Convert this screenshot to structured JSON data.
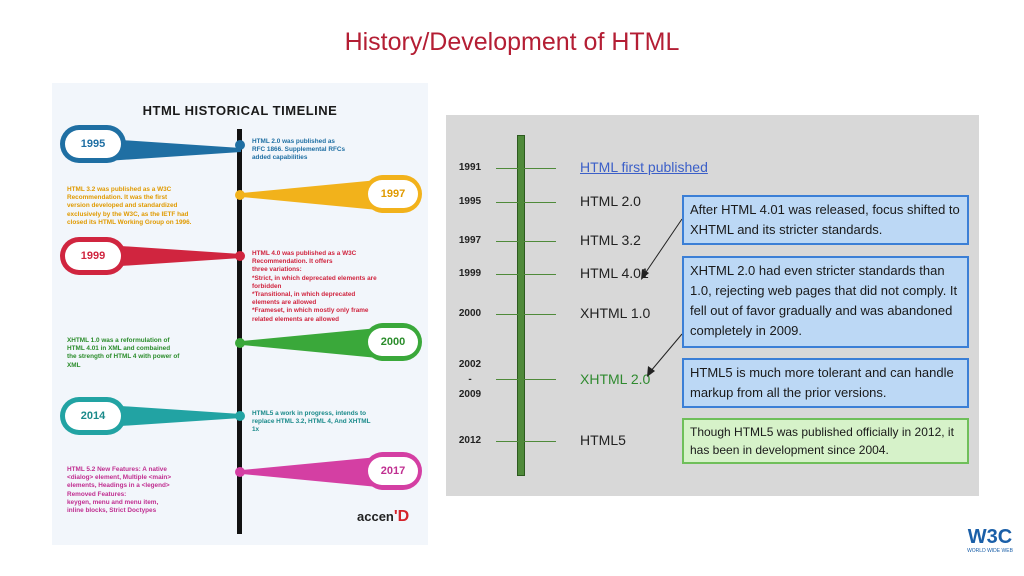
{
  "slide": {
    "title": "History/Development of HTML"
  },
  "left_infographic": {
    "heading": "HTML HISTORICAL TIMELINE",
    "entries": [
      {
        "year": "1995",
        "color": "#1f6fa3",
        "text": "HTML 2.0 was published as\nRFC 1866. Supplemental RFCs\nadded capabilities"
      },
      {
        "year": "1997",
        "color": "#f2b21b",
        "text": "HTML 3.2 was published as a W3C\nRecommendation. It was the first\nversion developed and standardized\nexclusively by the W3C, as the IETF had\nclosed its HTML Working Group on 1996."
      },
      {
        "year": "1999",
        "color": "#d0253f",
        "text": "HTML 4.0 was published as a W3C\nRecommendation. It offers\nthree variations:\n*Strict, in which deprecated elements are\nforbidden\n*Transitional, in which deprecated\nelements are allowed\n*Frameset, in which mostly only frame\nrelated elements are allowed"
      },
      {
        "year": "2000",
        "color": "#3aa83a",
        "text": "XHTML 1.0 was a  reformulation of\nHTML 4.01 in XML and combained\nthe strength of HTML 4 with  power of\nXML"
      },
      {
        "year": "2014",
        "color": "#22a3a3",
        "text": "HTML5 a work in progress, intends to\nreplace HTML 3.2, HTML 4,  And XHTML\n1x"
      },
      {
        "year": "2017",
        "color": "#d43fa3",
        "text": "HTML 5.2 New Features: A native\n<dialog> element,  Multiple <main>\nelements,  Headings in a <legend>\nRemoved Features:\nkeygen, menu and menu item,\ninline blocks, Strict Doctypes"
      }
    ],
    "logo": {
      "main": "accen",
      "accent": "'D"
    }
  },
  "right_timeline": {
    "rows": [
      {
        "year": "1991",
        "version": "HTML first published",
        "style": "link"
      },
      {
        "year": "1995",
        "version": "HTML 2.0",
        "style": "normal"
      },
      {
        "year": "1997",
        "version": "HTML 3.2",
        "style": "normal"
      },
      {
        "year": "1999",
        "version": "HTML 4.01",
        "style": "normal"
      },
      {
        "year": "2000",
        "version": "XHTML 1.0",
        "style": "normal"
      },
      {
        "year": "2002\n-\n2009",
        "version": "XHTML 2.0",
        "style": "green"
      },
      {
        "year": "2012",
        "version": "HTML5",
        "style": "normal"
      }
    ],
    "callouts": [
      {
        "text": "After HTML 4.01 was released, focus shifted to XHTML and its stricter standards.",
        "style": "blue"
      },
      {
        "text": "XHTML 2.0 had even stricter standards than 1.0, rejecting web pages that did not comply.  It fell out of favor gradually and was abandoned completely in 2009.",
        "style": "blue"
      },
      {
        "text": "HTML5 is much more tolerant and can handle markup from all the prior versions.",
        "style": "blue"
      },
      {
        "text": "Though HTML5 was published officially in 2012, it has been in development since 2004.",
        "style": "green"
      }
    ]
  },
  "w3c_logo": {
    "main": "W3C",
    "sub": "WORLD WIDE WEB"
  }
}
